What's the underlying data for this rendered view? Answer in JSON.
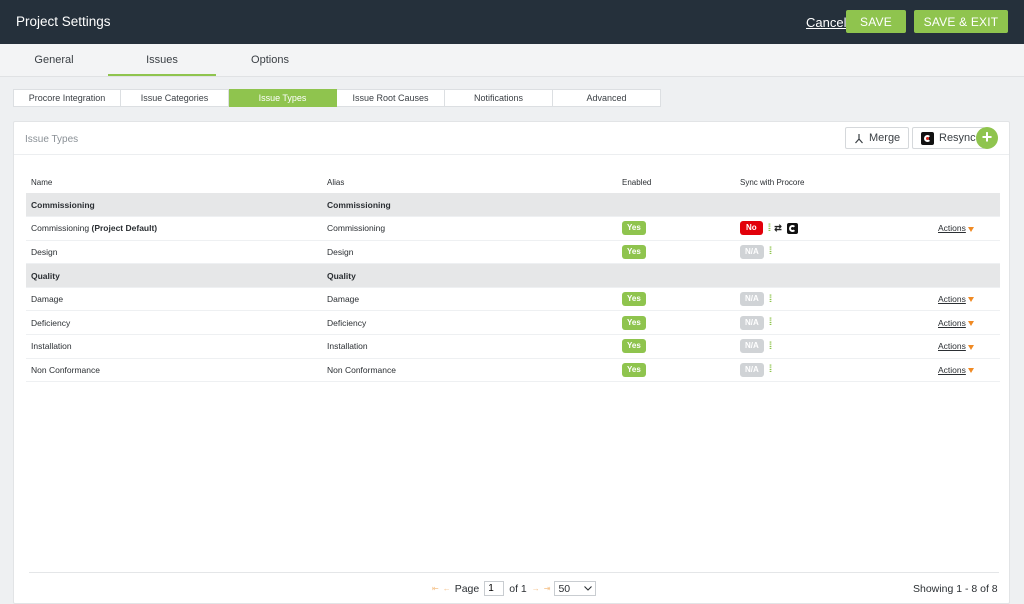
{
  "header": {
    "title": "Project Settings",
    "cancel_label": "Cancel",
    "save_label": "SAVE",
    "save_exit_label": "SAVE & EXIT"
  },
  "top_tabs": [
    "General",
    "Issues",
    "Options"
  ],
  "active_top_tab": "Issues",
  "sub_tabs": [
    "Procore Integration",
    "Issue Categories",
    "Issue Types",
    "Issue Root Causes",
    "Notifications",
    "Advanced"
  ],
  "active_sub_tab": "Issue Types",
  "panel": {
    "title": "Issue Types",
    "merge_label": "Merge",
    "resync_label": "Resync"
  },
  "table": {
    "headers": {
      "name": "Name",
      "alias": "Alias",
      "enabled": "Enabled",
      "sync": "Sync with Procore"
    },
    "groups": [
      {
        "name": "Commissioning",
        "alias": "Commissioning",
        "rows": [
          {
            "name": "Commissioning",
            "name_suffix": "(Project Default)",
            "alias": "Commissioning",
            "enabled": "Yes",
            "sync": "No",
            "actions": "Actions"
          },
          {
            "name": "Design",
            "name_suffix": "",
            "alias": "Design",
            "enabled": "Yes",
            "sync": "N/A",
            "actions": ""
          }
        ]
      },
      {
        "name": "Quality",
        "alias": "Quality",
        "rows": [
          {
            "name": "Damage",
            "name_suffix": "",
            "alias": "Damage",
            "enabled": "Yes",
            "sync": "N/A",
            "actions": "Actions"
          },
          {
            "name": "Deficiency",
            "name_suffix": "",
            "alias": "Deficiency",
            "enabled": "Yes",
            "sync": "N/A",
            "actions": "Actions"
          },
          {
            "name": "Installation",
            "name_suffix": "",
            "alias": "Installation",
            "enabled": "Yes",
            "sync": "N/A",
            "actions": "Actions"
          },
          {
            "name": "Non Conformance",
            "name_suffix": "",
            "alias": "Non Conformance",
            "enabled": "Yes",
            "sync": "N/A",
            "actions": "Actions"
          }
        ]
      }
    ]
  },
  "pager": {
    "page_label": "Page",
    "page_value": "1",
    "of_label": "of 1",
    "per_page": "50",
    "showing": "Showing 1 - 8 of 8"
  },
  "colors": {
    "accent": "#8fc44e",
    "header_bg": "#25303b",
    "no_red": "#e2000a",
    "caret": "#f08a24"
  },
  "icons": [
    "merge-icon",
    "procore-logo-icon",
    "plus-icon",
    "sync-dots-icon",
    "sync-link-icon",
    "chevron-down-icon",
    "caret-down-icon"
  ]
}
